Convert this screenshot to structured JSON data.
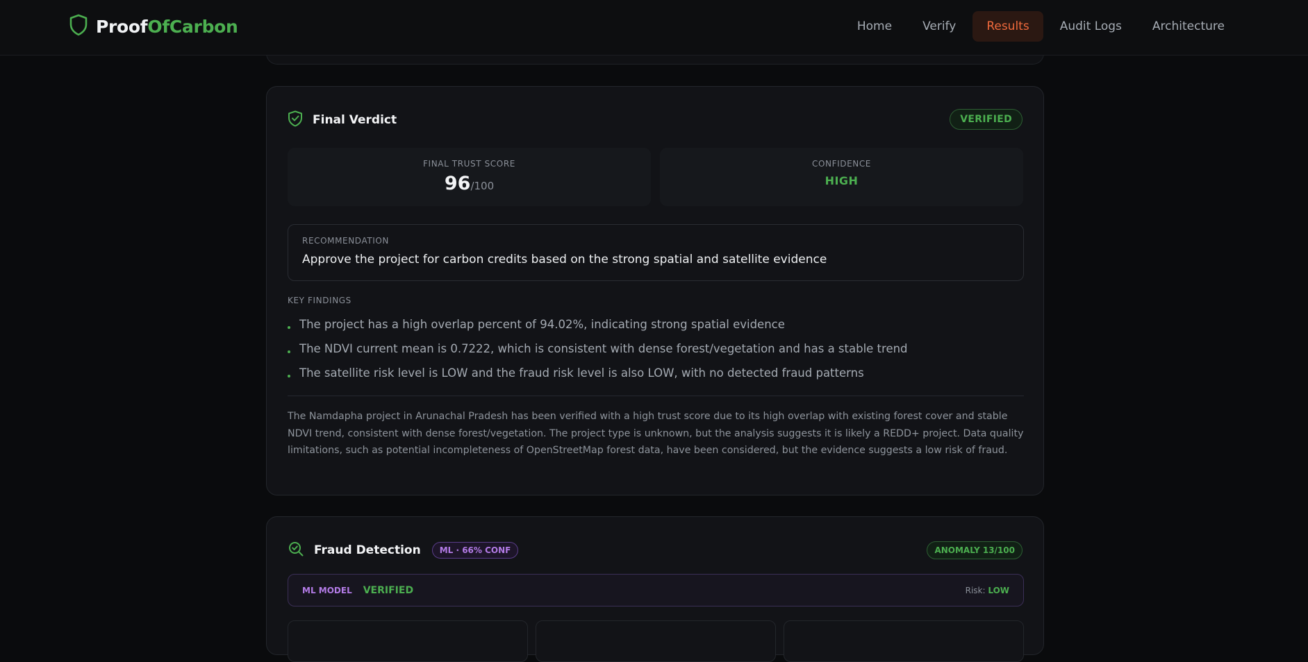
{
  "brand": {
    "name_a": "Proof",
    "name_b": "OfCarbon"
  },
  "nav": {
    "items": [
      {
        "label": "Home"
      },
      {
        "label": "Verify"
      },
      {
        "label": "Results"
      },
      {
        "label": "Audit Logs"
      },
      {
        "label": "Architecture"
      }
    ],
    "active": "Results"
  },
  "verdict": {
    "title": "Final Verdict",
    "status_badge": "VERIFIED",
    "trust_score": {
      "label": "FINAL TRUST SCORE",
      "value": "96",
      "suffix": "/100"
    },
    "confidence": {
      "label": "CONFIDENCE",
      "value": "HIGH"
    },
    "recommendation": {
      "label": "RECOMMENDATION",
      "text": "Approve the project for carbon credits based on the strong spatial and satellite evidence"
    },
    "key_findings": {
      "label": "KEY FINDINGS",
      "items": [
        "The project has a high overlap percent of 94.02%, indicating strong spatial evidence",
        "The NDVI current mean is 0.7222, which is consistent with dense forest/vegetation and has a stable trend",
        "The satellite risk level is LOW and the fraud risk level is also LOW, with no detected fraud patterns"
      ]
    },
    "summary": "The Namdapha project in Arunachal Pradesh has been verified with a high trust score due to its high overlap with existing forest cover and stable NDVI trend, consistent with dense forest/vegetation. The project type is unknown, but the analysis suggests it is likely a REDD+ project. Data quality limitations, such as potential incompleteness of OpenStreetMap forest data, have been considered, but the evidence suggests a low risk of fraud."
  },
  "fraud": {
    "title": "Fraud Detection",
    "ml_badge": "ML · 66% CONF",
    "anomaly_badge": "ANOMALY 13/100",
    "ml_row": {
      "model_label": "ML MODEL",
      "verdict": "VERIFIED",
      "risk_label": "Risk: ",
      "risk_value": "LOW"
    }
  },
  "colors": {
    "accent_green": "#4caf50",
    "active_nav_orange": "#f06a3c",
    "ml_purple": "#b37be6",
    "background": "#0a0b0d"
  },
  "icons": {
    "brand": "shield-icon",
    "verdict": "shield-check-icon",
    "fraud": "search-check-icon"
  }
}
